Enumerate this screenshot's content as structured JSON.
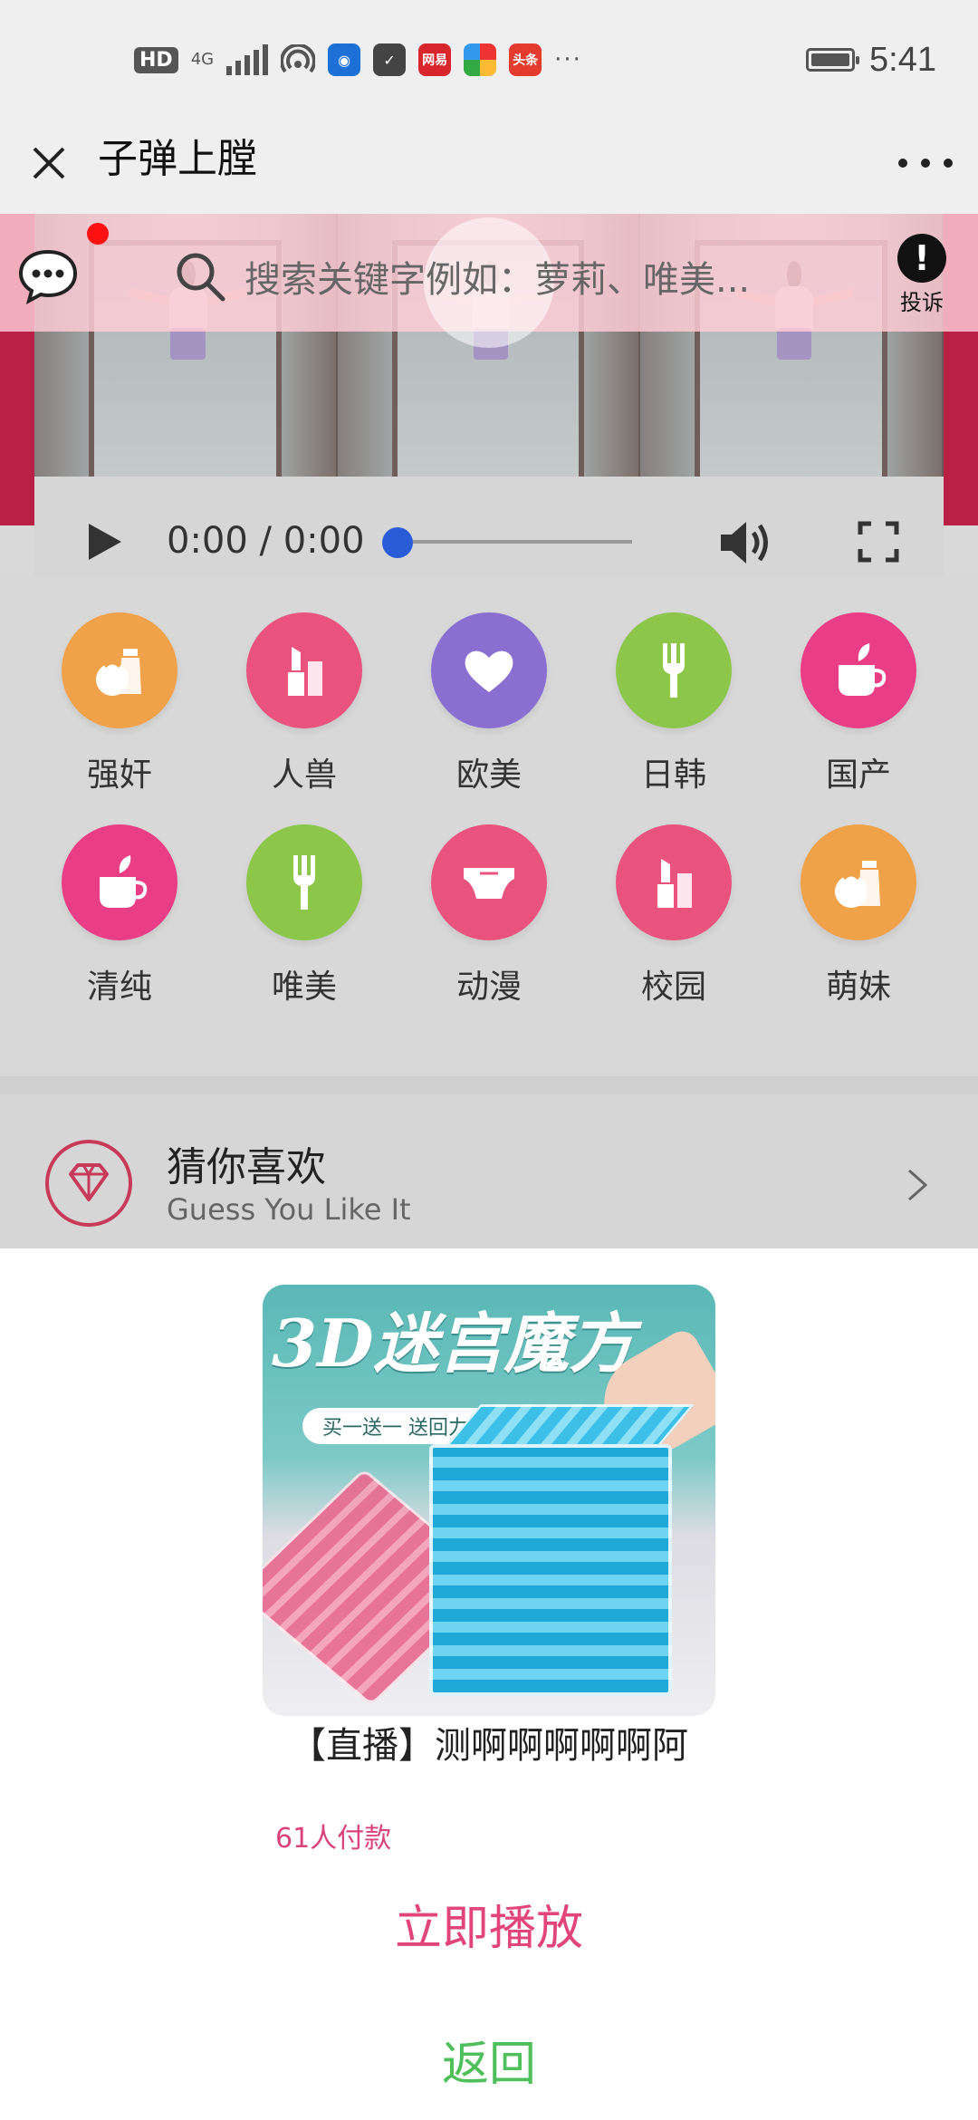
{
  "status_bar": {
    "hd": "HD",
    "network": "4G",
    "apps": [
      {
        "icon": "wallet-app-icon",
        "color": "#1e6fd6"
      },
      {
        "icon": "shield-app-icon",
        "color": "#444444"
      },
      {
        "icon": "netease-app-icon",
        "text": "网易",
        "color": "#d8262c"
      },
      {
        "icon": "colorful-app-icon",
        "color": "#3ea84a"
      },
      {
        "icon": "toutiao-app-icon",
        "text": "头条",
        "color": "#e33b2e"
      }
    ],
    "more": "···",
    "time": "5:41"
  },
  "header": {
    "title": "子弹上膛"
  },
  "search": {
    "placeholder": "搜索关键字例如：萝莉、唯美..."
  },
  "report": {
    "symbol": "!",
    "label": "投诉"
  },
  "player": {
    "time": "0:00 / 0:00",
    "progress": 0
  },
  "categories": [
    {
      "label": "强奸",
      "color": "#f0a24a",
      "icon": "milk-bottle-icon"
    },
    {
      "label": "人兽",
      "color": "#e9537d",
      "icon": "lipstick-icon"
    },
    {
      "label": "欧美",
      "color": "#8a6fd0",
      "icon": "heart-icon"
    },
    {
      "label": "日韩",
      "color": "#8cc64a",
      "icon": "fork-icon"
    },
    {
      "label": "国产",
      "color": "#e93e86",
      "icon": "cup-icon"
    },
    {
      "label": "清纯",
      "color": "#e93e86",
      "icon": "cup-icon"
    },
    {
      "label": "唯美",
      "color": "#8cc64a",
      "icon": "fork-icon"
    },
    {
      "label": "动漫",
      "color": "#e9537d",
      "icon": "diaper-icon"
    },
    {
      "label": "校园",
      "color": "#e9537d",
      "icon": "lipstick-icon"
    },
    {
      "label": "萌妹",
      "color": "#f0a24a",
      "icon": "milk-bottle-icon"
    }
  ],
  "guess": {
    "title": "猜你喜欢",
    "subtitle": "Guess You Like It"
  },
  "dialog": {
    "promo_title": "3D迷宫魔方",
    "promo_pill": "买一送一  送回力小车",
    "caption": "【直播】测啊啊啊啊啊阿",
    "paid": "61人付款",
    "play_now": "立即播放",
    "back": "返回"
  },
  "colors": {
    "accent_red": "#b82046",
    "play_pink": "#e2457a",
    "back_green": "#4fbf5c",
    "knob_blue": "#2b5cd8"
  }
}
